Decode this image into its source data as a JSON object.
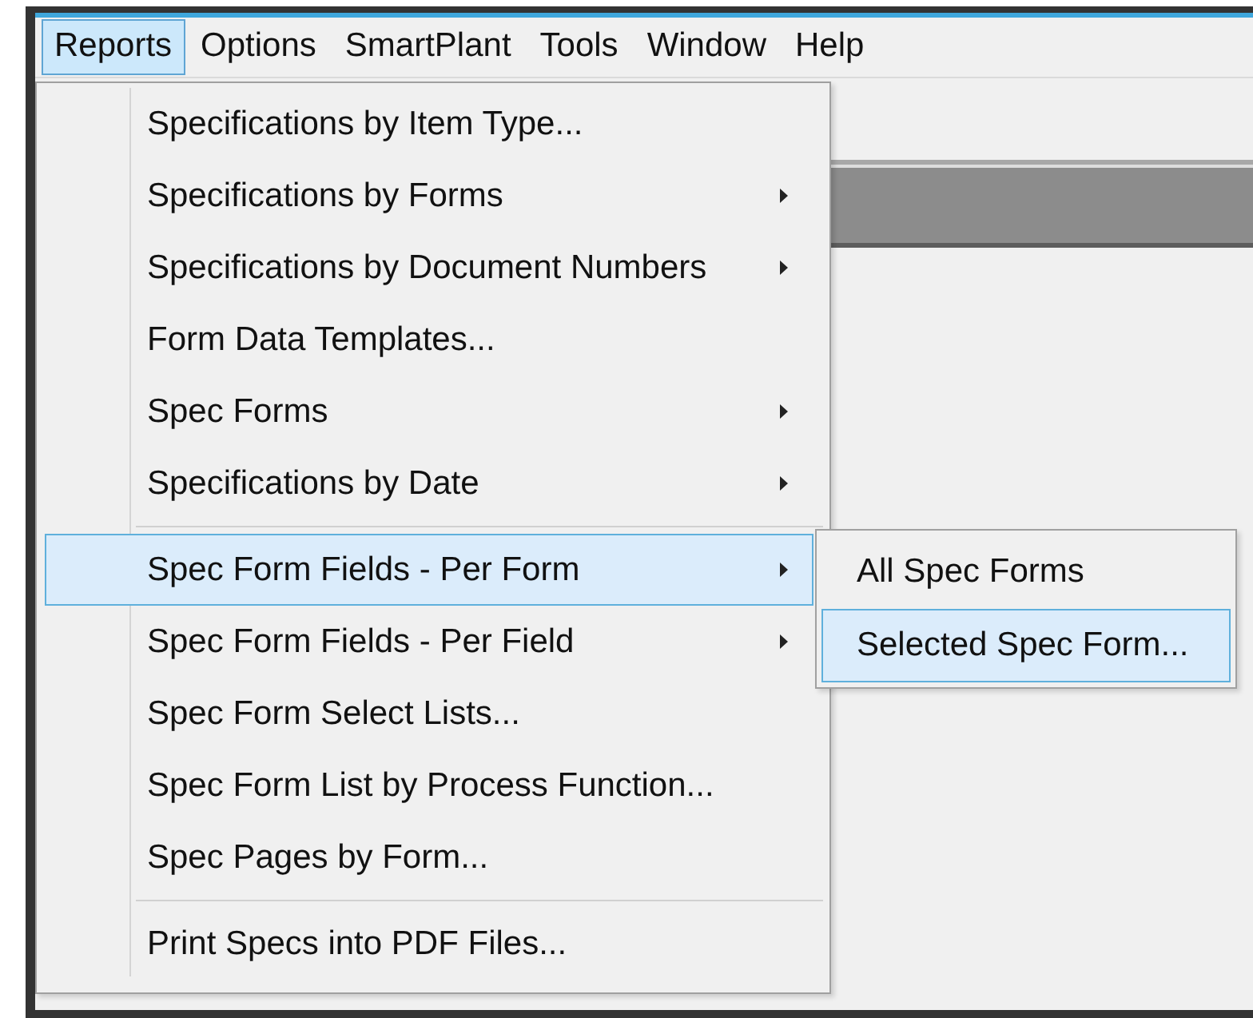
{
  "menu_bar": [
    {
      "label": "Reports",
      "selected": true
    },
    {
      "label": "Options",
      "selected": false
    },
    {
      "label": "SmartPlant",
      "selected": false
    },
    {
      "label": "Tools",
      "selected": false
    },
    {
      "label": "Window",
      "selected": false
    },
    {
      "label": "Help",
      "selected": false
    }
  ],
  "menu": [
    {
      "kind": "item",
      "label": "Specifications by Item Type...",
      "submenu": false,
      "selected": false
    },
    {
      "kind": "item",
      "label": "Specifications by Forms",
      "submenu": true,
      "selected": false
    },
    {
      "kind": "item",
      "label": "Specifications by Document Numbers",
      "submenu": true,
      "selected": false
    },
    {
      "kind": "item",
      "label": "Form Data Templates...",
      "submenu": false,
      "selected": false
    },
    {
      "kind": "item",
      "label": "Spec Forms",
      "submenu": true,
      "selected": false
    },
    {
      "kind": "item",
      "label": "Specifications by Date",
      "submenu": true,
      "selected": false
    },
    {
      "kind": "separator"
    },
    {
      "kind": "item",
      "label": "Spec Form Fields - Per Form",
      "submenu": true,
      "selected": true
    },
    {
      "kind": "item",
      "label": "Spec Form Fields - Per Field",
      "submenu": true,
      "selected": false
    },
    {
      "kind": "item",
      "label": "Spec Form Select Lists...",
      "submenu": false,
      "selected": false
    },
    {
      "kind": "item",
      "label": "Spec Form List by Process Function...",
      "submenu": false,
      "selected": false
    },
    {
      "kind": "item",
      "label": "Spec Pages by Form...",
      "submenu": false,
      "selected": false
    },
    {
      "kind": "separator"
    },
    {
      "kind": "item",
      "label": "Print Specs into PDF Files...",
      "submenu": false,
      "selected": false
    }
  ],
  "submenu": [
    {
      "label": "All Spec Forms",
      "selected": false
    },
    {
      "label": "Selected Spec Form...",
      "selected": true
    }
  ]
}
